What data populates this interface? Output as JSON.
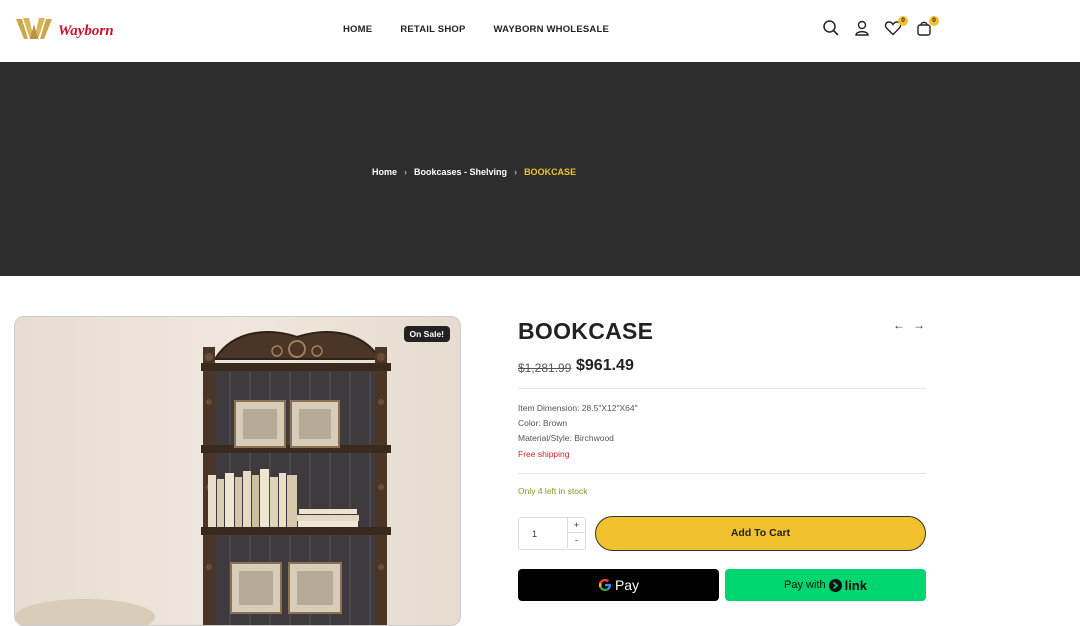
{
  "brand": {
    "name": "Wayborn",
    "logo_color": "#c9a74a",
    "text_color": "#c8102e"
  },
  "nav": [
    "HOME",
    "RETAIL SHOP",
    "WAYBORN WHOLESALE"
  ],
  "header_icons": {
    "search": "search-icon",
    "account": "user-icon",
    "wishlist": "heart-icon",
    "wishlist_count": "0",
    "cart": "cart-icon",
    "cart_count": "0"
  },
  "breadcrumb": {
    "home": "Home",
    "category": "Bookcases - Shelving",
    "current": "BOOKCASE"
  },
  "product": {
    "title": "BOOKCASE",
    "sale_badge": "On Sale!",
    "old_price": "$1,281.99",
    "price": "$961.49",
    "specs": [
      "Item Dimension: 28.5\"X12\"X64\"",
      "Color: Brown",
      "Material/Style: Birchwood"
    ],
    "shipping": "Free shipping",
    "stock": "Only 4 left in stock",
    "quantity": "1",
    "add_to_cart": "Add To Cart",
    "gpay_label": "Pay",
    "link_pay_prefix": "Pay with",
    "link_pay_word": "link"
  },
  "colors": {
    "accent": "#f2c12e",
    "hero_bg": "#2d2d2d",
    "link_green": "#00d66f",
    "free_shipping": "#d2261e",
    "stock": "#7a9a2a"
  }
}
